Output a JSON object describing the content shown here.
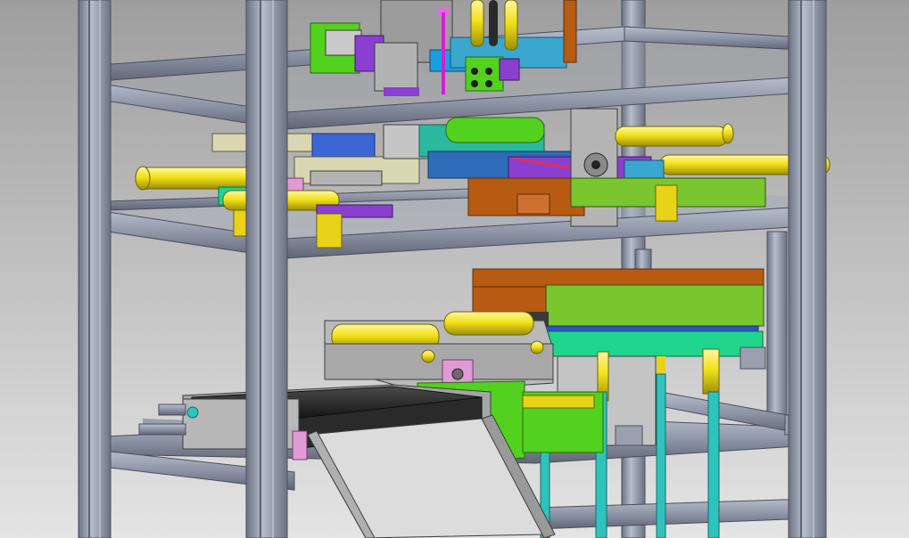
{
  "scene": {
    "kind": "cad-3d-assembly-render",
    "colors": {
      "background_top": "#9e9e9e",
      "background_bottom": "#e2e2e2",
      "frame_aluminum": "#8f97a8",
      "frame_dark": "#5e6474",
      "cylinder_yellow": "#f2e21a",
      "bracket_green": "#52d11e",
      "plate_teal": "#1fd58c",
      "pillar_cyan": "#2ec4bd",
      "cover_orange": "#b75a12",
      "block_purple": "#8a3fd0",
      "block_blue": "#3a66d6",
      "plate_gray": "#b9b9b9",
      "belt_black": "#2a2a2a",
      "block_tan": "#d9d6b2",
      "pink_accent": "#e36be0"
    },
    "icons": [
      "aluminum-frame",
      "pneumatic-cylinder",
      "conveyor-belt",
      "chute",
      "gripper-module"
    ]
  }
}
